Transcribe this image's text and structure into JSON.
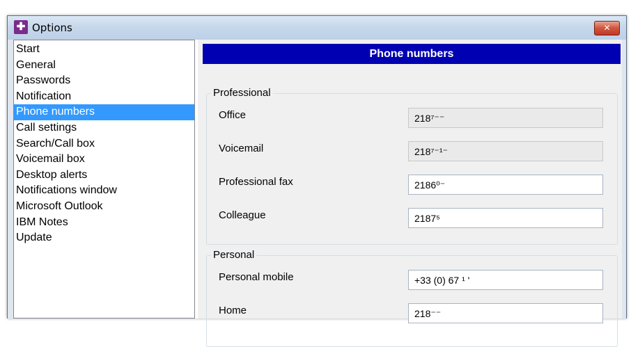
{
  "window": {
    "title": "Options",
    "close_label": "✕"
  },
  "sidebar": {
    "items": [
      {
        "label": "Start"
      },
      {
        "label": "General"
      },
      {
        "label": "Passwords"
      },
      {
        "label": "Notification"
      },
      {
        "label": "Phone numbers",
        "selected": true
      },
      {
        "label": "Call settings"
      },
      {
        "label": "Search/Call box"
      },
      {
        "label": "Voicemail box"
      },
      {
        "label": "Desktop alerts"
      },
      {
        "label": "Notifications window"
      },
      {
        "label": "Microsoft Outlook"
      },
      {
        "label": "IBM Notes"
      },
      {
        "label": "Update"
      }
    ]
  },
  "content": {
    "header": "Phone numbers",
    "professional": {
      "legend": "Professional",
      "fields": [
        {
          "label": "Office",
          "value": "218⁷⁻⁻",
          "readonly": true
        },
        {
          "label": "Voicemail",
          "value": "218⁷⁻¹⁻",
          "readonly": true
        },
        {
          "label": "Professional fax",
          "value": "2186⁰⁻",
          "readonly": false
        },
        {
          "label": "Colleague",
          "value": "2187⁵",
          "readonly": false
        }
      ]
    },
    "personal": {
      "legend": "Personal",
      "fields": [
        {
          "label": "Personal mobile",
          "value": "+33 (0) 67 ¹ '",
          "readonly": false
        },
        {
          "label": "Home",
          "value": "218⁻⁻",
          "readonly": false
        }
      ]
    }
  },
  "colors": {
    "selection": "#3399ff",
    "header_bar": "#0000b3",
    "close_button": "#c0392b",
    "app_icon": "#7a2b8c"
  },
  "icons": {
    "app": "options-app-icon",
    "close": "close-icon"
  }
}
